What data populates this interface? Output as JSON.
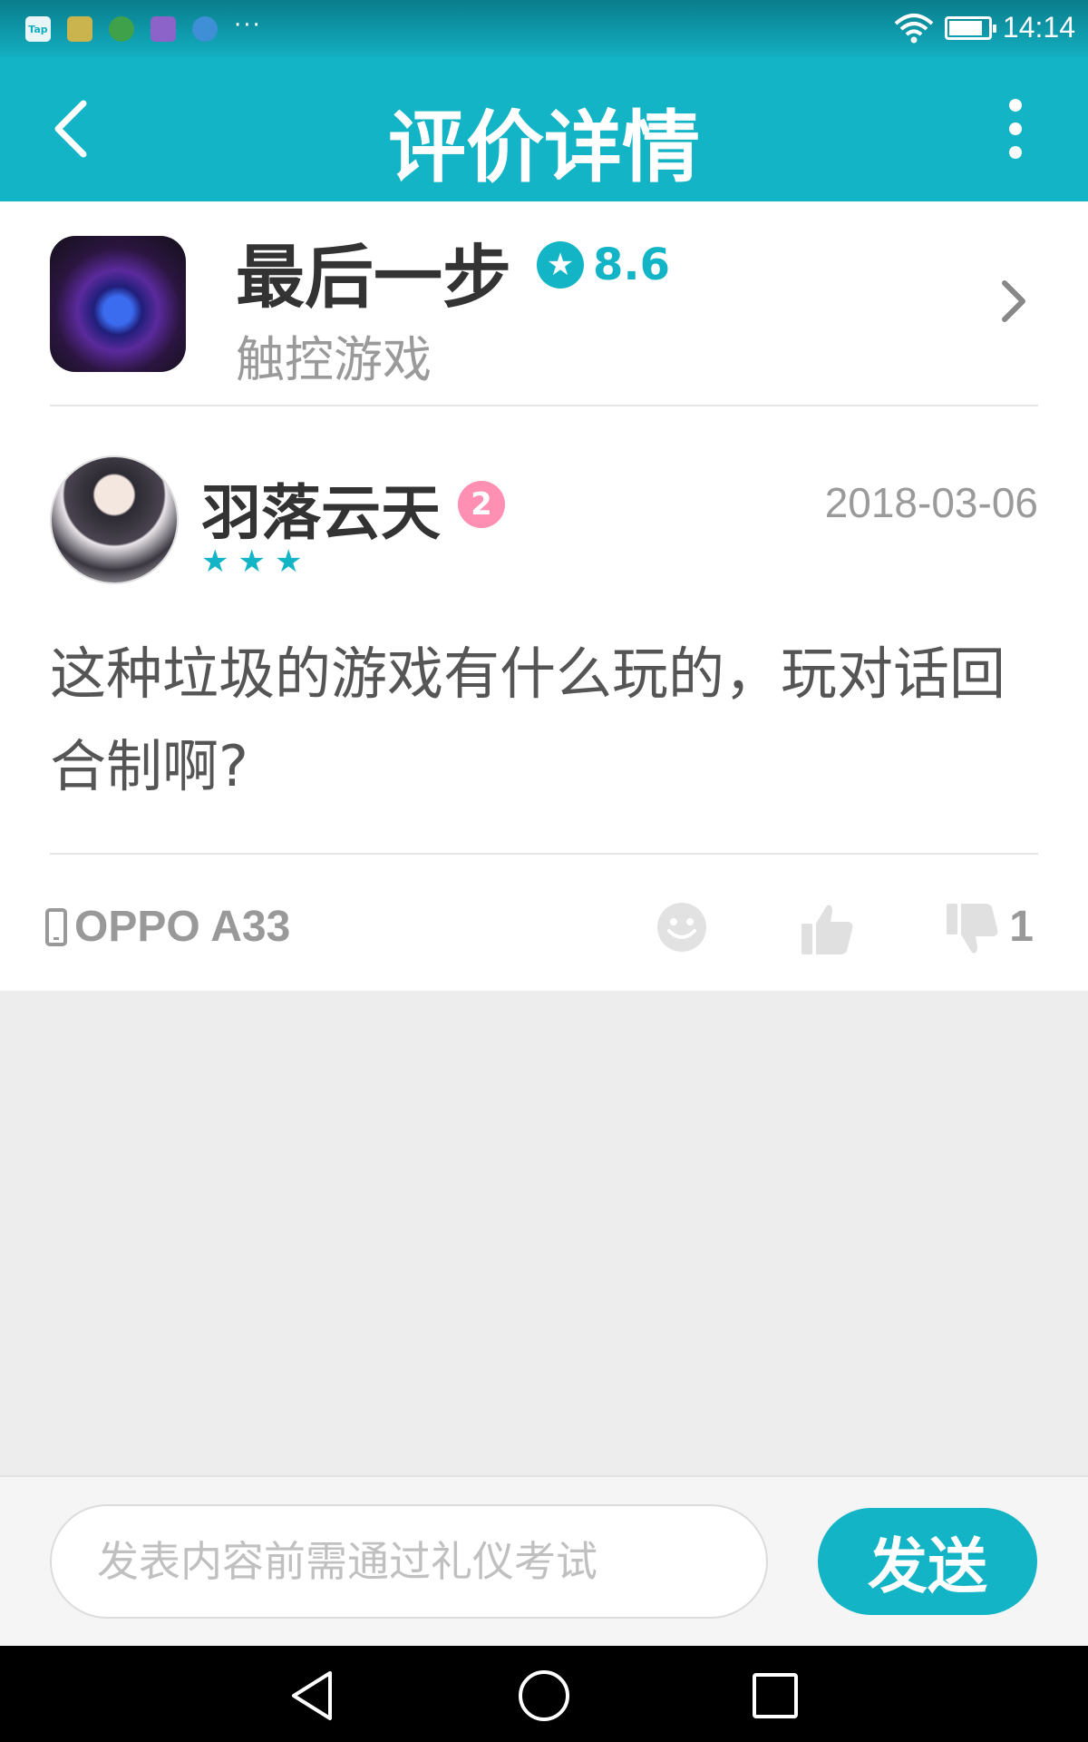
{
  "status_bar": {
    "app_icons": [
      "Tap",
      "",
      "",
      "",
      ""
    ],
    "more_indicator": "···",
    "time": "14:14",
    "battery_level": 0.85
  },
  "header": {
    "title": "评价详情"
  },
  "game": {
    "name": "最后一步",
    "score": "8.6",
    "category": "触控游戏"
  },
  "review": {
    "user_name": "羽落云天",
    "level": "2",
    "date": "2018-03-06",
    "rating_stars": 3,
    "text": "这种垃圾的游戏有什么玩的，玩对话回合制啊?",
    "device": "OPPO A33",
    "dislike_count": "1"
  },
  "comment_bar": {
    "placeholder": "发表内容前需通过礼仪考试",
    "send_label": "发送"
  },
  "colors": {
    "accent": "#12b4c5",
    "level_badge": "#ff8fb3"
  }
}
